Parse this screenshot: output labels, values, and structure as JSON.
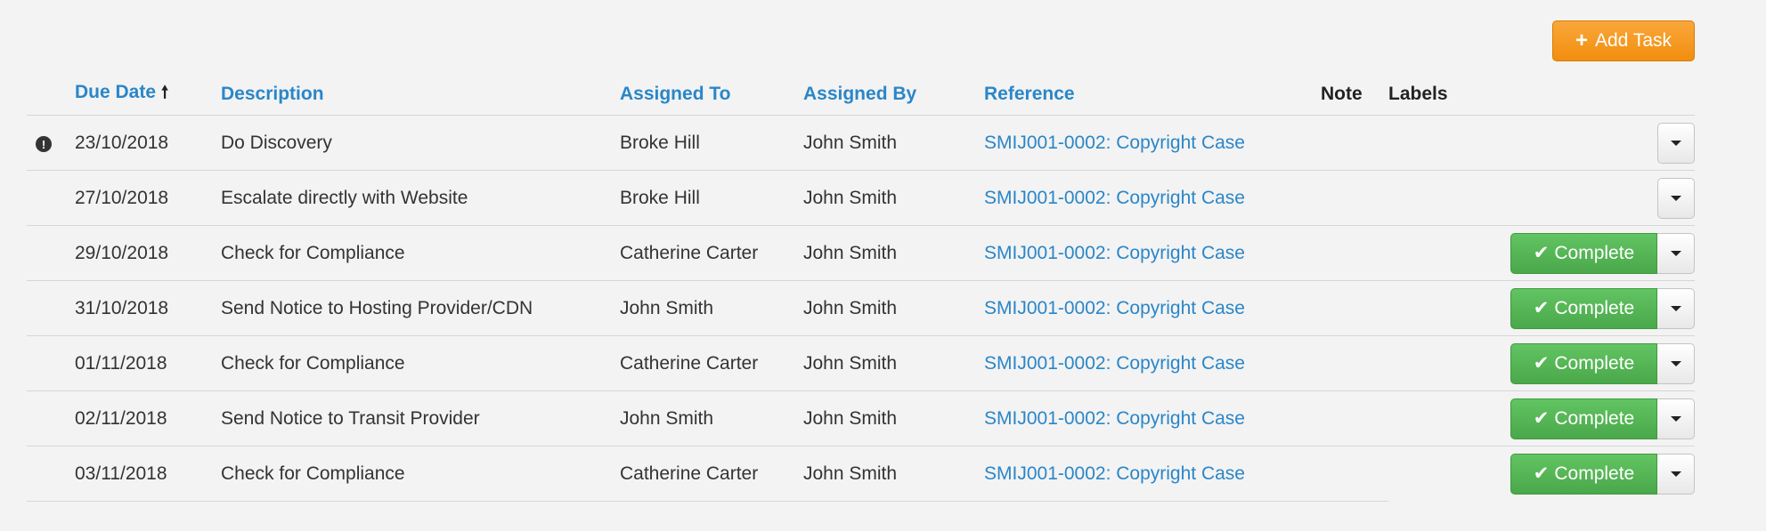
{
  "toolbar": {
    "add_task_label": "Add Task",
    "add_icon": "plus-icon"
  },
  "columns": {
    "due_date": "Due Date",
    "description": "Description",
    "assigned_to": "Assigned To",
    "assigned_by": "Assigned By",
    "reference": "Reference",
    "note": "Note",
    "labels": "Labels"
  },
  "sort": {
    "column": "due_date",
    "direction": "ascending",
    "icon": "arrow-up-icon"
  },
  "colors": {
    "link": "#2a86c8",
    "complete": "#5cb85c",
    "add_task": "#f39c12"
  },
  "complete_label": "Complete",
  "rows": [
    {
      "due_date": "23/10/2018",
      "description": "Do Discovery",
      "assigned_to": "Broke Hill",
      "assigned_by": "John Smith",
      "reference": "SMIJ001-0002: Copyright Case",
      "alert": true,
      "can_complete": false
    },
    {
      "due_date": "27/10/2018",
      "description": "Escalate directly with Website",
      "assigned_to": "Broke Hill",
      "assigned_by": "John Smith",
      "reference": "SMIJ001-0002: Copyright Case",
      "alert": false,
      "can_complete": false
    },
    {
      "due_date": "29/10/2018",
      "description": "Check for Compliance",
      "assigned_to": "Catherine Carter",
      "assigned_by": "John Smith",
      "reference": "SMIJ001-0002: Copyright Case",
      "alert": false,
      "can_complete": true
    },
    {
      "due_date": "31/10/2018",
      "description": "Send Notice to Hosting Provider/CDN",
      "assigned_to": "John Smith",
      "assigned_by": "John Smith",
      "reference": "SMIJ001-0002: Copyright Case",
      "alert": false,
      "can_complete": true
    },
    {
      "due_date": "01/11/2018",
      "description": "Check for Compliance",
      "assigned_to": "Catherine Carter",
      "assigned_by": "John Smith",
      "reference": "SMIJ001-0002: Copyright Case",
      "alert": false,
      "can_complete": true
    },
    {
      "due_date": "02/11/2018",
      "description": "Send Notice to Transit Provider",
      "assigned_to": "John Smith",
      "assigned_by": "John Smith",
      "reference": "SMIJ001-0002: Copyright Case",
      "alert": false,
      "can_complete": true
    },
    {
      "due_date": "03/11/2018",
      "description": "Check for Compliance",
      "assigned_to": "Catherine Carter",
      "assigned_by": "John Smith",
      "reference": "SMIJ001-0002: Copyright Case",
      "alert": false,
      "can_complete": true
    }
  ]
}
